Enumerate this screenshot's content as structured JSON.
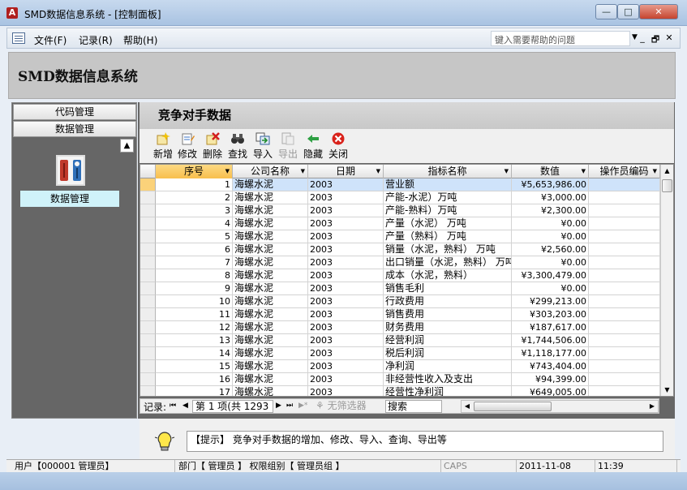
{
  "window": {
    "app_icon_letter": "A",
    "title": "SMD数据信息系统 - [控制面板]",
    "min_label": "—",
    "max_label": "□",
    "close_label": "✕"
  },
  "menubar": {
    "items": [
      "文件(F)",
      "记录(R)",
      "帮助(H)"
    ],
    "help_placeholder": "键入需要帮助的问题",
    "mdi_min": "_",
    "mdi_restore": "🗗",
    "mdi_close": "✕"
  },
  "header": {
    "system_title": "SMD数据信息系统"
  },
  "nav": {
    "tabs": [
      "代码管理",
      "数据管理"
    ],
    "scroll_up": "▲",
    "item_label": "数据管理"
  },
  "main": {
    "section_title": "竞争对手数据",
    "toolbar": [
      {
        "label": "新增",
        "icon": "add-icon",
        "enabled": true
      },
      {
        "label": "修改",
        "icon": "edit-icon",
        "enabled": true
      },
      {
        "label": "删除",
        "icon": "delete-icon",
        "enabled": true
      },
      {
        "label": "查找",
        "icon": "binoculars-icon",
        "enabled": true
      },
      {
        "label": "导入",
        "icon": "import-icon",
        "enabled": true
      },
      {
        "label": "导出",
        "icon": "export-icon",
        "enabled": false
      },
      {
        "label": "隐藏",
        "icon": "hide-arrow-icon",
        "enabled": true
      },
      {
        "label": "关闭",
        "icon": "close-red-icon",
        "enabled": true
      }
    ]
  },
  "grid": {
    "columns": [
      "序号",
      "公司名称",
      "日期",
      "指标名称",
      "数值",
      "操作员编码"
    ],
    "rows": [
      {
        "seq": "1",
        "company": "海螺水泥",
        "date": "2003",
        "metric": "营业额",
        "value": "¥5,653,986.00",
        "operator": ""
      },
      {
        "seq": "2",
        "company": "海螺水泥",
        "date": "2003",
        "metric": "产能-水泥）万吨",
        "value": "¥3,000.00",
        "operator": ""
      },
      {
        "seq": "3",
        "company": "海螺水泥",
        "date": "2003",
        "metric": "产能-熟料）万吨",
        "value": "¥2,300.00",
        "operator": ""
      },
      {
        "seq": "4",
        "company": "海螺水泥",
        "date": "2003",
        "metric": "产量（水泥） 万吨",
        "value": "¥0.00",
        "operator": ""
      },
      {
        "seq": "5",
        "company": "海螺水泥",
        "date": "2003",
        "metric": "产量（熟料） 万吨",
        "value": "¥0.00",
        "operator": ""
      },
      {
        "seq": "6",
        "company": "海螺水泥",
        "date": "2003",
        "metric": "销量（水泥，熟料） 万吨",
        "value": "¥2,560.00",
        "operator": ""
      },
      {
        "seq": "7",
        "company": "海螺水泥",
        "date": "2003",
        "metric": "出口销量（水泥，熟料） 万吨",
        "value": "¥0.00",
        "operator": ""
      },
      {
        "seq": "8",
        "company": "海螺水泥",
        "date": "2003",
        "metric": "成本（水泥，熟料）",
        "value": "¥3,300,479.00",
        "operator": ""
      },
      {
        "seq": "9",
        "company": "海螺水泥",
        "date": "2003",
        "metric": "销售毛利",
        "value": "¥0.00",
        "operator": ""
      },
      {
        "seq": "10",
        "company": "海螺水泥",
        "date": "2003",
        "metric": "行政费用",
        "value": "¥299,213.00",
        "operator": ""
      },
      {
        "seq": "11",
        "company": "海螺水泥",
        "date": "2003",
        "metric": "销售费用",
        "value": "¥303,203.00",
        "operator": ""
      },
      {
        "seq": "12",
        "company": "海螺水泥",
        "date": "2003",
        "metric": "财务费用",
        "value": "¥187,617.00",
        "operator": ""
      },
      {
        "seq": "13",
        "company": "海螺水泥",
        "date": "2003",
        "metric": "经营利润",
        "value": "¥1,744,506.00",
        "operator": ""
      },
      {
        "seq": "14",
        "company": "海螺水泥",
        "date": "2003",
        "metric": "税后利润",
        "value": "¥1,118,177.00",
        "operator": ""
      },
      {
        "seq": "15",
        "company": "海螺水泥",
        "date": "2003",
        "metric": "净利润",
        "value": "¥743,404.00",
        "operator": ""
      },
      {
        "seq": "16",
        "company": "海螺水泥",
        "date": "2003",
        "metric": "非经营性收入及支出",
        "value": "¥94,399.00",
        "operator": ""
      },
      {
        "seq": "17",
        "company": "海螺水泥",
        "date": "2003",
        "metric": "经营性净利润",
        "value": "¥649,005.00",
        "operator": ""
      }
    ],
    "selected_row": 0
  },
  "navigator": {
    "label": "记录:",
    "first": "⏮",
    "prev": "◀",
    "record": "第 1 项(共 1293",
    "next": "▶",
    "last": "⏭",
    "new": "▶*",
    "filter": "无筛选器",
    "search": "搜索"
  },
  "tip": {
    "text": "【提示】 竞争对手数据的增加、修改、导入、查询、导出等"
  },
  "statusbar": {
    "user": "用户【000001 管理员】",
    "department": "部门【 管理员 】 权限组别【 管理员组 】",
    "caps": "CAPS",
    "date": "2011-11-08",
    "time": "11:39"
  }
}
